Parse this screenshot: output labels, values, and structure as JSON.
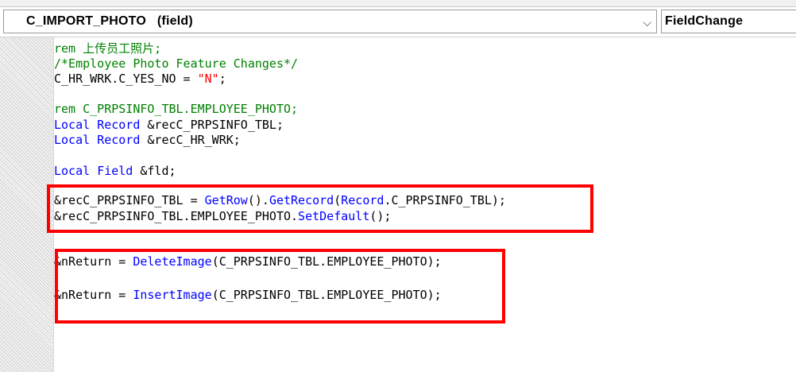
{
  "header": {
    "object_name": "C_IMPORT_PHOTO   (field)",
    "event_name": "FieldChange",
    "chevron_glyph": "⌵"
  },
  "colors": {
    "comment": "#008000",
    "keyword": "#0000ff",
    "string": "#ff0000",
    "highlight_border": "#ff0000"
  },
  "code": {
    "lines": [
      [
        {
          "t": "rem 上传员工照片;",
          "c": "comment"
        }
      ],
      [
        {
          "t": "/*Employee Photo Feature Changes*/",
          "c": "comment"
        }
      ],
      [
        {
          "t": "C_HR_WRK.C_YES_NO = ",
          "c": "plain"
        },
        {
          "t": "\"N\"",
          "c": "string"
        },
        {
          "t": ";",
          "c": "plain"
        }
      ],
      [],
      [
        {
          "t": "rem C_PRPSINFO_TBL.EMPLOYEE_PHOTO;",
          "c": "comment"
        }
      ],
      [
        {
          "t": "Local ",
          "c": "keyword"
        },
        {
          "t": "Record",
          "c": "keyword"
        },
        {
          "t": " &recC_PRPSINFO_TBL;",
          "c": "plain"
        }
      ],
      [
        {
          "t": "Local ",
          "c": "keyword"
        },
        {
          "t": "Record",
          "c": "keyword"
        },
        {
          "t": " &recC_HR_WRK;",
          "c": "plain"
        }
      ],
      [],
      [
        {
          "t": "Local ",
          "c": "keyword"
        },
        {
          "t": "Field",
          "c": "keyword"
        },
        {
          "t": " &fld;",
          "c": "plain"
        }
      ],
      [],
      [
        {
          "t": "&recC_PRPSINFO_TBL = ",
          "c": "plain"
        },
        {
          "t": "GetRow",
          "c": "keyword"
        },
        {
          "t": "().",
          "c": "plain"
        },
        {
          "t": "GetRecord",
          "c": "keyword"
        },
        {
          "t": "(",
          "c": "plain"
        },
        {
          "t": "Record",
          "c": "keyword"
        },
        {
          "t": ".C_PRPSINFO_TBL);",
          "c": "plain"
        }
      ],
      [
        {
          "t": "&recC_PRPSINFO_TBL.EMPLOYEE_PHOTO.",
          "c": "plain"
        },
        {
          "t": "SetDefault",
          "c": "keyword"
        },
        {
          "t": "();",
          "c": "plain"
        }
      ],
      [],
      [],
      [
        {
          "t": "&nReturn = ",
          "c": "plain"
        },
        {
          "t": "DeleteImage",
          "c": "keyword"
        },
        {
          "t": "(C_PRPSINFO_TBL.EMPLOYEE_PHOTO);",
          "c": "plain"
        }
      ],
      [],
      [
        {
          "t": "&nReturn = ",
          "c": "plain"
        },
        {
          "t": "InsertImage",
          "c": "keyword"
        },
        {
          "t": "(C_PRPSINFO_TBL.EMPLOYEE_PHOTO);",
          "c": "plain"
        }
      ]
    ]
  }
}
